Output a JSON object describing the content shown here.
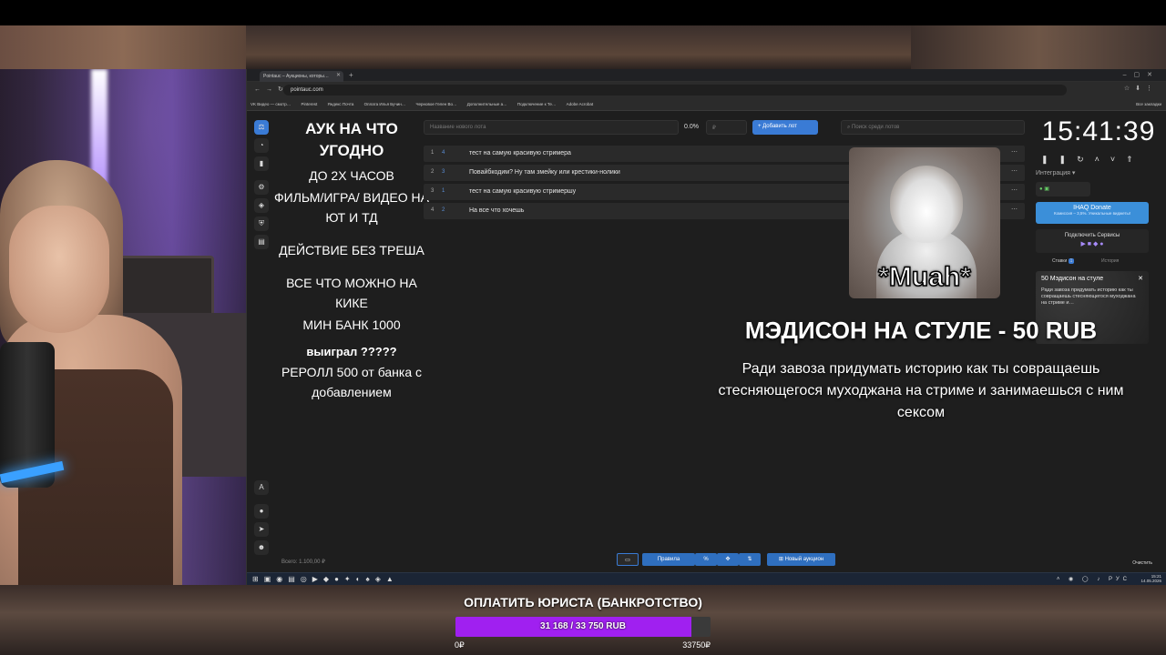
{
  "browser": {
    "tab_title": "Pointauc – Аукционы, которы…",
    "url": "pointauc.com",
    "bookmarks": [
      "VK Видео — смотр…",
      "Pinterest",
      "Яндекс Почта",
      "Оплата Илья Бучин…",
      "Черновое Гелен Во…",
      "Дополнительные а…",
      "Подключение к Те…",
      "Adobe Acrobat"
    ],
    "all_bookmarks": "Все закладки"
  },
  "rules": {
    "line1": "АУК НА ЧТО УГОДНО",
    "line2": "ДО 2Х ЧАСОВ",
    "line3": "ФИЛЬМ/ИГРА/ ВИДЕО НА ЮТ И ТД",
    "line4": "ДЕЙСТВИЕ БЕЗ ТРЕША",
    "line5": "ВСЕ ЧТО МОЖНО НА КИКЕ",
    "line6": "МИН БАНК 1000",
    "line7": "выиграл ?????",
    "line8": "РЕРОЛЛ 500 от банка с добавлением"
  },
  "controls": {
    "lot_placeholder": "Название нового лота",
    "percent": "0.0%",
    "amount_placeholder": "₽",
    "add_button": "Добавить лот",
    "search_placeholder": "Поиск среди лотов"
  },
  "lots": [
    {
      "n": "1",
      "v": "4",
      "text": "тест на самую красивую стримера"
    },
    {
      "n": "2",
      "v": "3",
      "text": "Повайбкодим? Ну там змейку или крестики-нолики"
    },
    {
      "n": "3",
      "v": "1",
      "text": "тест на самую красивую стримершу"
    },
    {
      "n": "4",
      "v": "2",
      "text": "На все что хочешь"
    }
  ],
  "overlay": {
    "muah": "*Muah*",
    "donation_title": "МЭДИСОН НА СТУЛЕ - 50 RUB",
    "donation_message": "Ради завоза придумать историю как ты совращаешь стесняющегося муходжана на стриме и занимаешься с ним сексом"
  },
  "panel": {
    "clock": "15:41:39",
    "integrations": "Интеграция",
    "donate_title": "IHAQ Donate",
    "donate_sub": "Комиссия – 3,5%. Уникальные виджеты!",
    "services": "Подключить Сервисы",
    "tab_bets": "Ставки",
    "tab_bets_count": "1",
    "tab_history": "История",
    "card_title": "50 Мэдисон на стуле",
    "card_message": "Ради завоза придумать историю как ты совращаешь стесняющегося муходжана на стриме и…"
  },
  "bottom": {
    "total": "Всего: 1.100,00 ₽",
    "rules_button": "Правила",
    "new_auction": "Новый аукцион",
    "clear": "Очистить"
  },
  "taskbar": {
    "lang": "РУС",
    "time": "15:21",
    "date": "14.05.2026"
  },
  "goal": {
    "title": "ОПЛАТИТЬ ЮРИСТА (БАНКРОТСТВО)",
    "progress_text": "31 168 / 33 750 RUB",
    "current": 31168,
    "target": 33750,
    "min_label": "0₽",
    "max_label": "33750₽",
    "fill_color": "#a020f0"
  }
}
